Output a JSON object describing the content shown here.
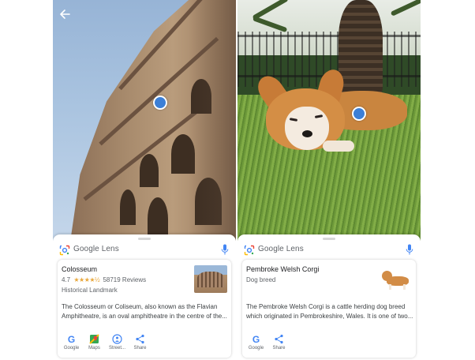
{
  "panels": [
    {
      "lens_title": "Google Lens",
      "result": {
        "title": "Colosseum",
        "rating": "4.7",
        "stars": "★★★★½",
        "reviews": "58719 Reviews",
        "subtype": "Historical Landmark",
        "description": "The Colosseum or Coliseum, also known as the Flavian Amphitheatre, is an oval amphitheatre in the centre of the..."
      },
      "actions": [
        {
          "label": "Google",
          "icon": "google-icon"
        },
        {
          "label": "Maps",
          "icon": "maps-icon"
        },
        {
          "label": "Street...",
          "icon": "street-view-icon"
        },
        {
          "label": "Share",
          "icon": "share-icon"
        }
      ]
    },
    {
      "lens_title": "Google Lens",
      "result": {
        "title": "Pembroke Welsh Corgi",
        "subtype": "Dog breed",
        "description": "The Pembroke Welsh Corgi is a cattle herding dog breed which originated in Pembrokeshire, Wales. It is one of two..."
      },
      "actions": [
        {
          "label": "Google",
          "icon": "google-icon"
        },
        {
          "label": "Share",
          "icon": "share-icon"
        }
      ]
    }
  ],
  "colors": {
    "focus_dot": "#3c7fd6",
    "google_blue": "#4285f4",
    "star": "#e8a73b"
  }
}
